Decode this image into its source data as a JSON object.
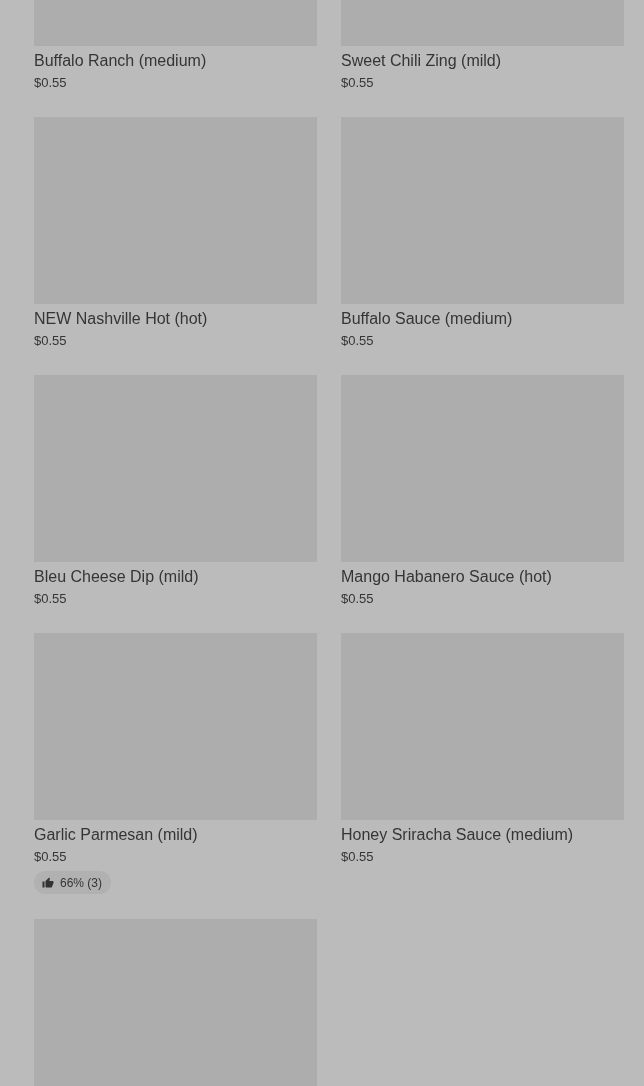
{
  "items": [
    {
      "kind": "item",
      "name": "Buffalo Ranch (medium)",
      "price": "$0.55"
    },
    {
      "kind": "item",
      "name": "Sweet Chili Zing (mild)",
      "price": "$0.55"
    },
    {
      "kind": "item",
      "name": "NEW Nashville Hot (hot)",
      "price": "$0.55"
    },
    {
      "kind": "item",
      "name": "Buffalo Sauce (medium)",
      "price": "$0.55"
    },
    {
      "kind": "item",
      "name": "Bleu Cheese Dip (mild)",
      "price": "$0.55"
    },
    {
      "kind": "item",
      "name": "Mango Habanero Sauce (hot)",
      "price": "$0.55"
    },
    {
      "kind": "item",
      "name": "Garlic Parmesan (mild)",
      "price": "$0.55",
      "rating": "66% (3)"
    },
    {
      "kind": "item",
      "name": "Honey Sriracha Sauce (medium)",
      "price": "$0.55"
    },
    {
      "kind": "image_only"
    }
  ]
}
